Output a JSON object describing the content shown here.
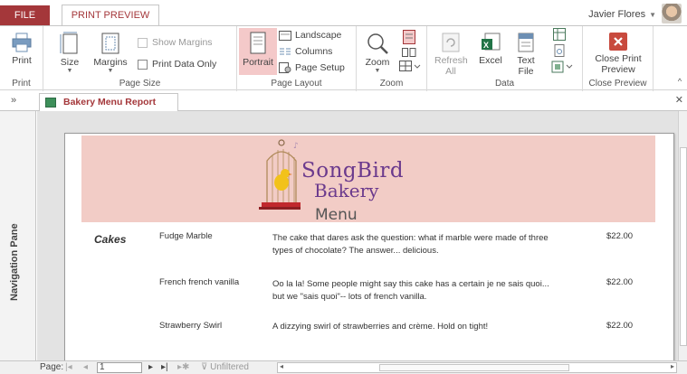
{
  "tabs": {
    "file": "FILE",
    "print_preview": "PRINT PREVIEW"
  },
  "user": {
    "name": "Javier Flores"
  },
  "ribbon": {
    "groups": {
      "print": "Print",
      "page_size": "Page Size",
      "page_layout": "Page Layout",
      "zoom": "Zoom",
      "data": "Data",
      "close_preview": "Close Preview"
    },
    "print_button": "Print",
    "size_button": "Size",
    "margins_button": "Margins",
    "show_margins": "Show Margins",
    "print_data_only": "Print Data Only",
    "portrait": "Portrait",
    "landscape": "Landscape",
    "columns": "Columns",
    "page_setup": "Page Setup",
    "zoom_button": "Zoom",
    "refresh_all_1": "Refresh",
    "refresh_all_2": "All",
    "excel": "Excel",
    "text_file_1": "Text",
    "text_file_2": "File",
    "close_print_preview_1": "Close Print",
    "close_print_preview_2": "Preview"
  },
  "document": {
    "tab_title": "Bakery Menu Report",
    "nav_pane_label": "Navigation Pane"
  },
  "report": {
    "logo_line1": "SongBird",
    "logo_line2": "Bakery",
    "menu_title": "Menu",
    "category": "Cakes",
    "items": [
      {
        "name": "Fudge Marble",
        "description": "The cake that dares ask the question: what if marble were made of three types of chocolate? The answer... delicious.",
        "price": "$22.00"
      },
      {
        "name": "French french vanilla",
        "description": "Oo la la! Some people might say this cake has a certain je ne sais quoi... but we \"sais quoi\"-- lots of french vanilla.",
        "price": "$22.00"
      },
      {
        "name": "Strawberry Swirl",
        "description": "A dizzying swirl of strawberries and crème. Hold on tight!",
        "price": "$22.00"
      }
    ]
  },
  "statusbar": {
    "page_label": "Page:",
    "page_value": "1",
    "filter": "Unfiltered"
  },
  "colors": {
    "accent": "#a4373a",
    "banner": "#f2ccc6",
    "logo_purple": "#6b3a8d",
    "portrait_highlight": "#f4c9c9"
  }
}
